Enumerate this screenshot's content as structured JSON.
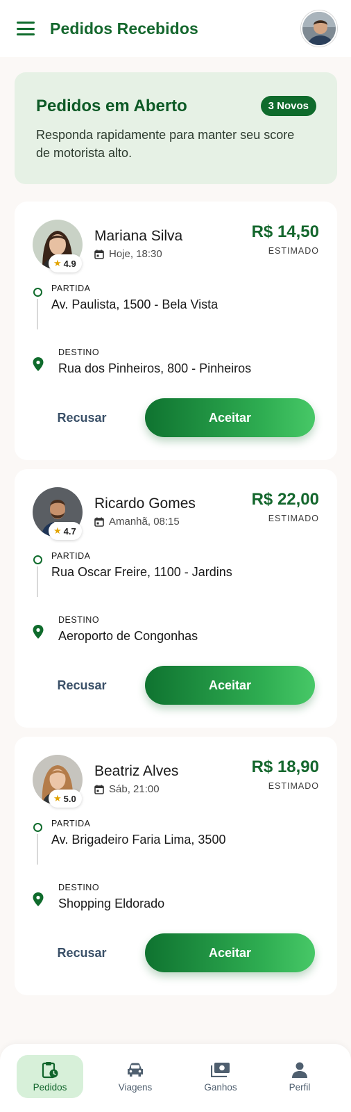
{
  "header": {
    "title": "Pedidos Recebidos",
    "avatar": "driver-avatar"
  },
  "banner": {
    "title": "Pedidos em Aberto",
    "badge": "3 Novos",
    "text_line1": "Responda rapidamente para manter seu score",
    "text_line2": "de motorista alto."
  },
  "labels": {
    "estimated": "ESTIMADO",
    "departure": "PARTIDA",
    "destination": "DESTINO",
    "decline": "Recusar",
    "accept": "Aceitar"
  },
  "requests": [
    {
      "name": "Mariana Silva",
      "rating": "4.9",
      "time": "Hoje, 18:30",
      "price": "R$ 14,50",
      "from": "Av. Paulista, 1500 - Bela Vista",
      "to": "Rua dos Pinheiros, 800 - Pinheiros"
    },
    {
      "name": "Ricardo Gomes",
      "rating": "4.7",
      "time": "Amanhã, 08:15",
      "price": "R$ 22,00",
      "from": "Rua Oscar Freire, 1100 - Jardins",
      "to": "Aeroporto de Congonhas"
    },
    {
      "name": "Beatriz Alves",
      "rating": "5.0",
      "time": "Sáb, 21:00",
      "price": "R$ 18,90",
      "from": "Av. Brigadeiro Faria Lima, 3500",
      "to": "Shopping Eldorado"
    }
  ],
  "nav": {
    "items": [
      {
        "label": "Pedidos",
        "icon": "clipboard-clock-icon",
        "active": true
      },
      {
        "label": "Viagens",
        "icon": "car-icon",
        "active": false
      },
      {
        "label": "Ganhos",
        "icon": "money-icon",
        "active": false
      },
      {
        "label": "Perfil",
        "icon": "person-icon",
        "active": false
      }
    ]
  },
  "colors": {
    "primary": "#14672d",
    "accent": "#2fae52",
    "banner_bg": "#e6f1e5",
    "nav_active_bg": "#d7f0d9"
  }
}
